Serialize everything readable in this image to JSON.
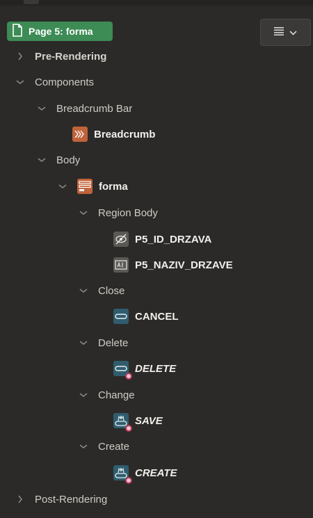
{
  "page": {
    "label": "Page 5: forma",
    "icon": "page-icon"
  },
  "toolbar": {
    "menu_icon": "hamburger-icon",
    "dropdown_icon": "chevron-down-icon"
  },
  "tree": {
    "pre_rendering": "Pre-Rendering",
    "components": "Components",
    "breadcrumb_bar": "Breadcrumb Bar",
    "breadcrumb": "Breadcrumb",
    "body": "Body",
    "forma": "forma",
    "region_body": "Region Body",
    "p5_id": "P5_ID_DRZAVA",
    "p5_naziv": "P5_NAZIV_DRZAVE",
    "close": "Close",
    "cancel": "CANCEL",
    "delete_pos": "Delete",
    "delete_btn": "DELETE",
    "change": "Change",
    "save": "SAVE",
    "create_pos": "Create",
    "create_btn": "CREATE",
    "post_rendering": "Post-Rendering"
  },
  "colors": {
    "page_chip": "#3d8b55",
    "region_icon": "#c0623a",
    "button_icon": "#2f5d6e",
    "item_icon": "#5a5955",
    "badge": "#b8375a"
  }
}
